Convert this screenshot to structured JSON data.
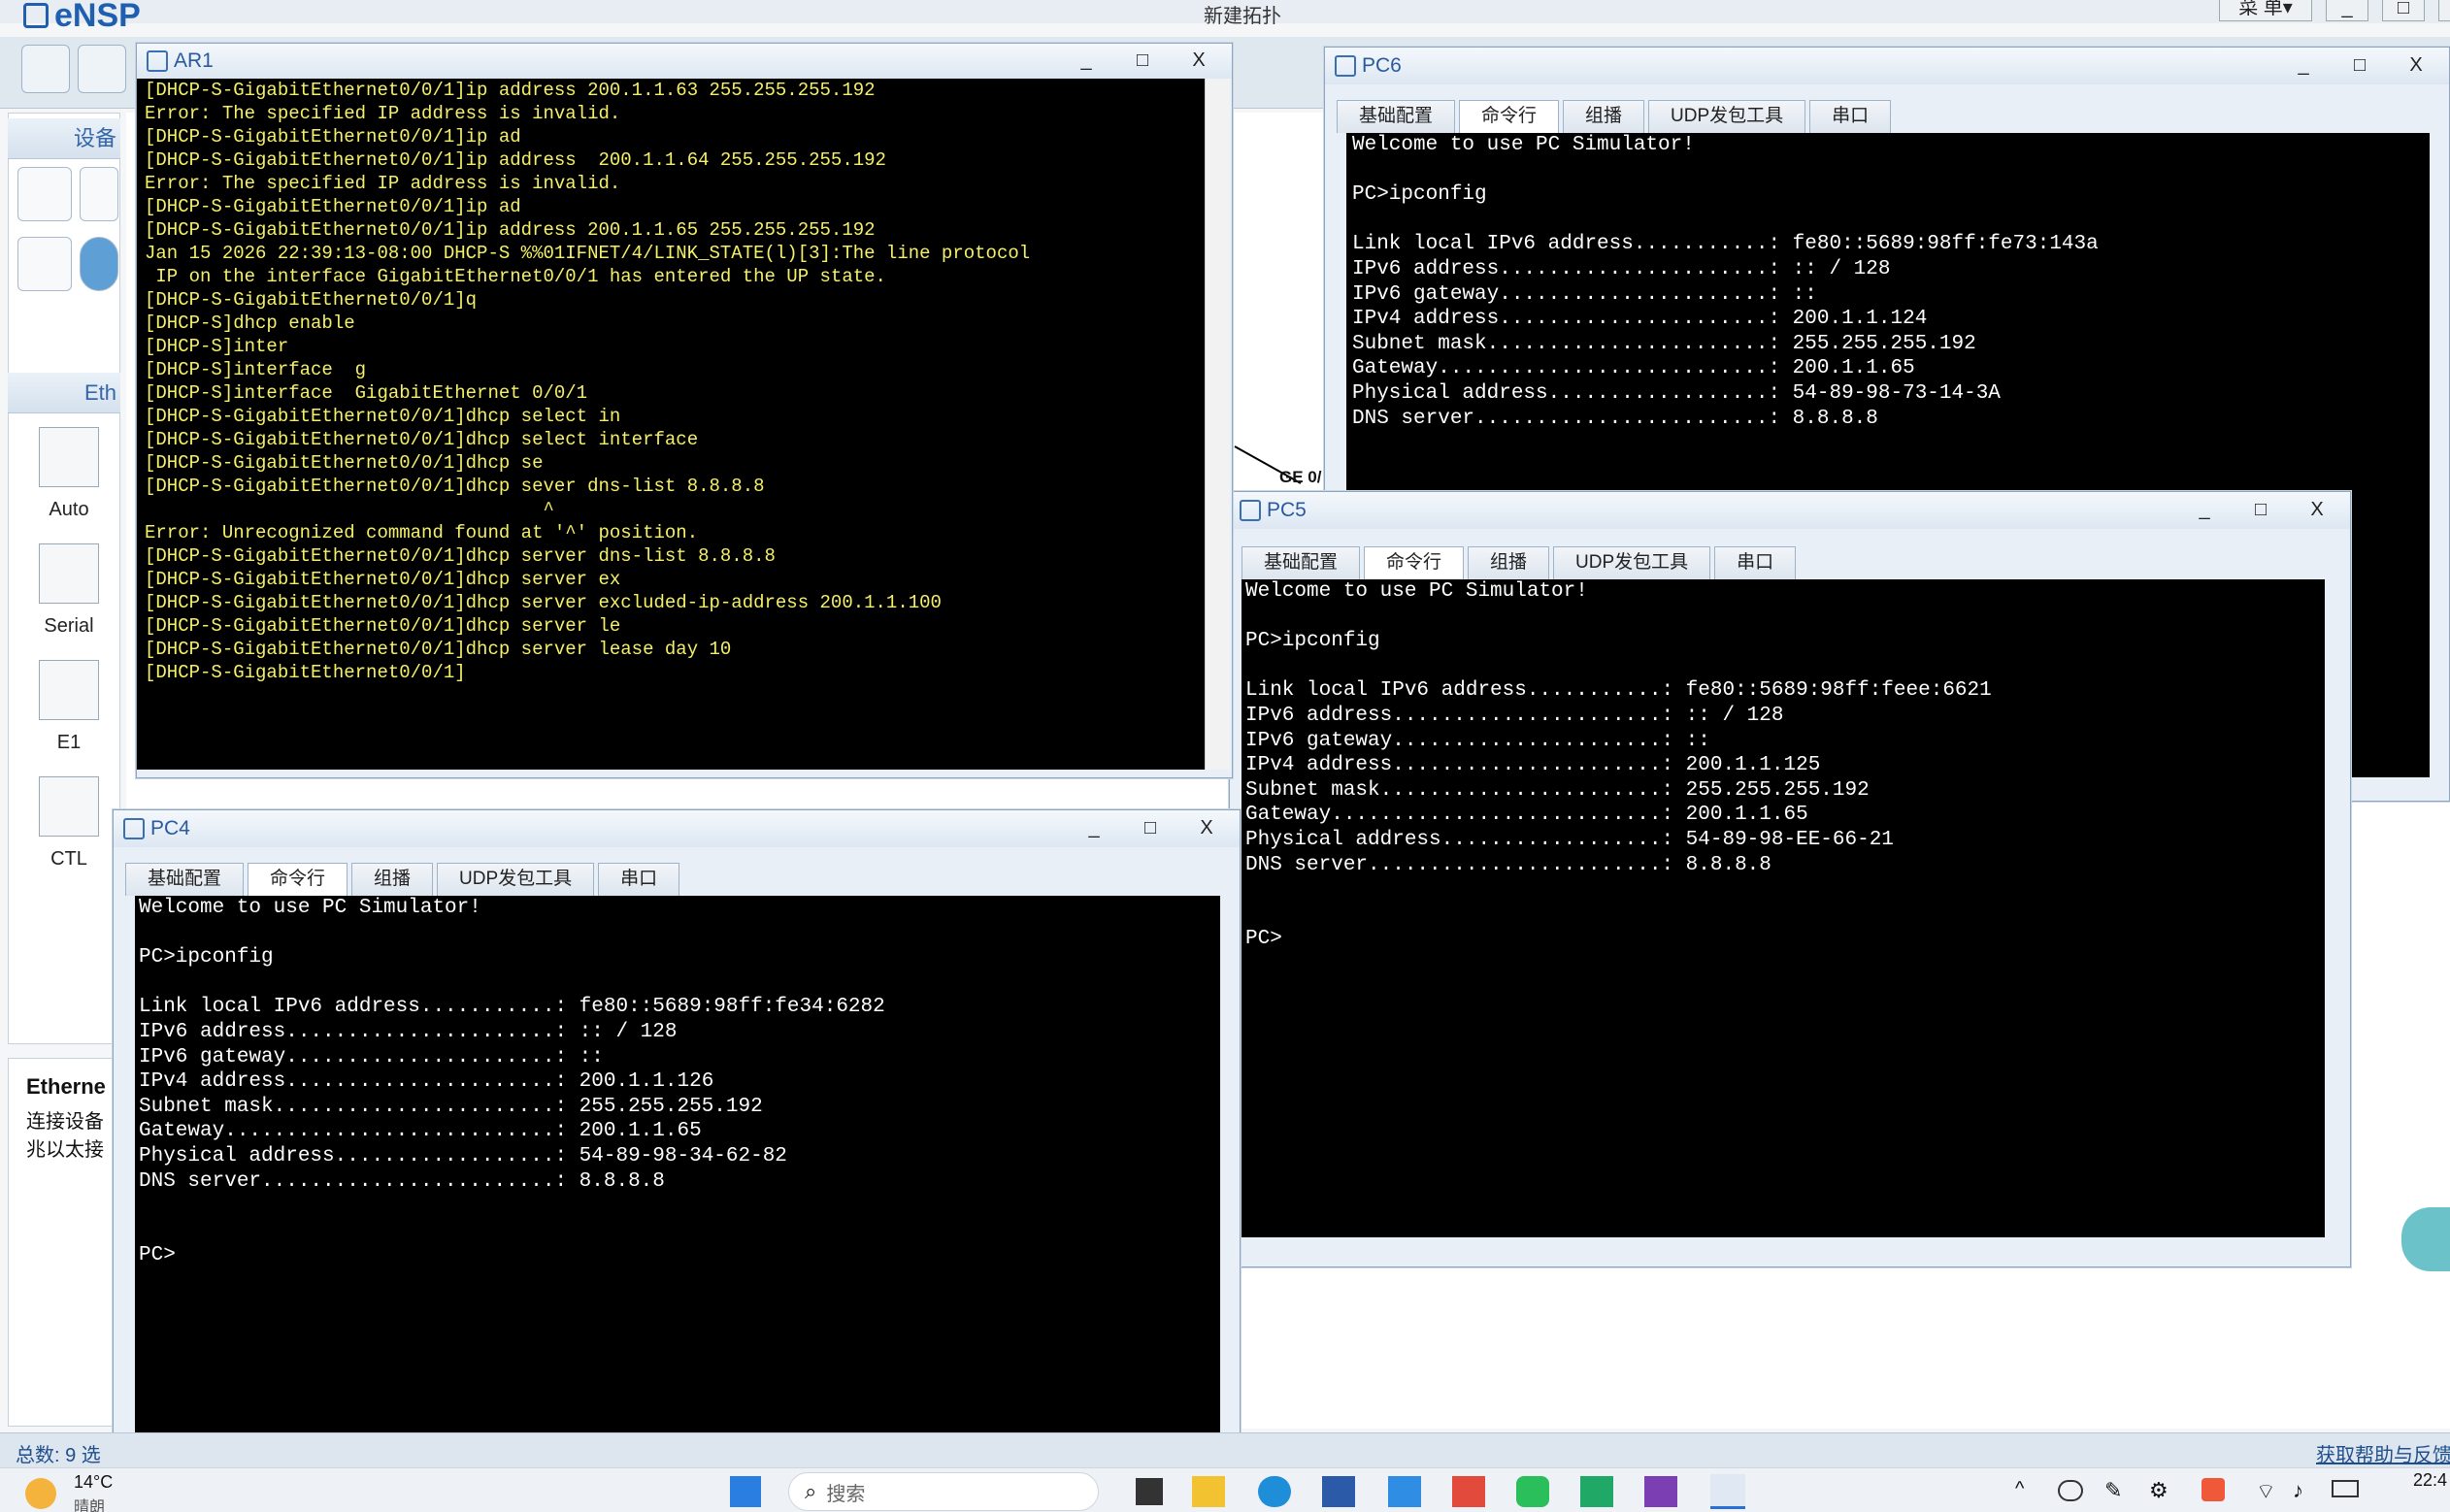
{
  "app": {
    "name": "eNSP",
    "window_title": "新建拓扑",
    "menu_label": "菜 单▾"
  },
  "left_panel": {
    "section1": "设备",
    "section2": "Eth",
    "cables": [
      {
        "label": "Auto"
      },
      {
        "label": "Serial"
      },
      {
        "label": "E1"
      },
      {
        "label": "CTL"
      }
    ],
    "info_title": "Etherne",
    "info_text_1": "连接设备",
    "info_text_2": "兆以太接"
  },
  "canvas": {
    "port_label": "GE 0/"
  },
  "status": {
    "total": "总数: 9  选",
    "help": "获取帮助与反馈"
  },
  "ar1": {
    "title": "AR1",
    "lines": [
      "[DHCP-S-GigabitEthernet0/0/1]ip address 200.1.1.63 255.255.255.192",
      "Error: The specified IP address is invalid.",
      "[DHCP-S-GigabitEthernet0/0/1]ip ad",
      "[DHCP-S-GigabitEthernet0/0/1]ip address  200.1.1.64 255.255.255.192",
      "Error: The specified IP address is invalid.",
      "[DHCP-S-GigabitEthernet0/0/1]ip ad",
      "[DHCP-S-GigabitEthernet0/0/1]ip address 200.1.1.65 255.255.255.192",
      "Jan 15 2026 22:39:13-08:00 DHCP-S %%01IFNET/4/LINK_STATE(l)[3]:The line protocol",
      " IP on the interface GigabitEthernet0/0/1 has entered the UP state.",
      "[DHCP-S-GigabitEthernet0/0/1]q",
      "[DHCP-S]dhcp enable",
      "[DHCP-S]inter",
      "[DHCP-S]interface  g",
      "[DHCP-S]interface  GigabitEthernet 0/0/1",
      "[DHCP-S-GigabitEthernet0/0/1]dhcp select in",
      "[DHCP-S-GigabitEthernet0/0/1]dhcp select interface",
      "[DHCP-S-GigabitEthernet0/0/1]dhcp se",
      "[DHCP-S-GigabitEthernet0/0/1]dhcp sever dns-list 8.8.8.8",
      "                                    ^",
      "Error: Unrecognized command found at '^' position.",
      "[DHCP-S-GigabitEthernet0/0/1]dhcp server dns-list 8.8.8.8",
      "[DHCP-S-GigabitEthernet0/0/1]dhcp server ex",
      "[DHCP-S-GigabitEthernet0/0/1]dhcp server excluded-ip-address 200.1.1.100",
      "[DHCP-S-GigabitEthernet0/0/1]dhcp server le",
      "[DHCP-S-GigabitEthernet0/0/1]dhcp server lease day 10",
      "[DHCP-S-GigabitEthernet0/0/1]"
    ]
  },
  "pc_tabs": [
    "基础配置",
    "命令行",
    "组播",
    "UDP发包工具",
    "串口"
  ],
  "pc6": {
    "title": "PC6",
    "lines": [
      "Welcome to use PC Simulator!",
      "",
      "PC>ipconfig",
      "",
      "Link local IPv6 address...........: fe80::5689:98ff:fe73:143a",
      "IPv6 address......................: :: / 128",
      "IPv6 gateway......................: ::",
      "IPv4 address......................: 200.1.1.124",
      "Subnet mask.......................: 255.255.255.192",
      "Gateway...........................: 200.1.1.65",
      "Physical address..................: 54-89-98-73-14-3A",
      "DNS server........................: 8.8.8.8"
    ]
  },
  "pc5": {
    "title": "PC5",
    "lines": [
      "Welcome to use PC Simulator!",
      "",
      "PC>ipconfig",
      "",
      "Link local IPv6 address...........: fe80::5689:98ff:feee:6621",
      "IPv6 address......................: :: / 128",
      "IPv6 gateway......................: ::",
      "IPv4 address......................: 200.1.1.125",
      "Subnet mask.......................: 255.255.255.192",
      "Gateway...........................: 200.1.1.65",
      "Physical address..................: 54-89-98-EE-66-21",
      "DNS server........................: 8.8.8.8",
      "",
      "",
      "PC>"
    ]
  },
  "pc4": {
    "title": "PC4",
    "lines": [
      "Welcome to use PC Simulator!",
      "",
      "PC>ipconfig",
      "",
      "Link local IPv6 address...........: fe80::5689:98ff:fe34:6282",
      "IPv6 address......................: :: / 128",
      "IPv6 gateway......................: ::",
      "IPv4 address......................: 200.1.1.126",
      "Subnet mask.......................: 255.255.255.192",
      "Gateway...........................: 200.1.1.65",
      "Physical address..................: 54-89-98-34-62-82",
      "DNS server........................: 8.8.8.8",
      "",
      "",
      "PC>"
    ]
  },
  "window_controls": {
    "min": "_",
    "max": "□",
    "close": "X"
  },
  "taskbar": {
    "weather_temp": "14°C",
    "weather_desc": "晴朗",
    "search_placeholder": "搜索",
    "clock": "22:4"
  }
}
